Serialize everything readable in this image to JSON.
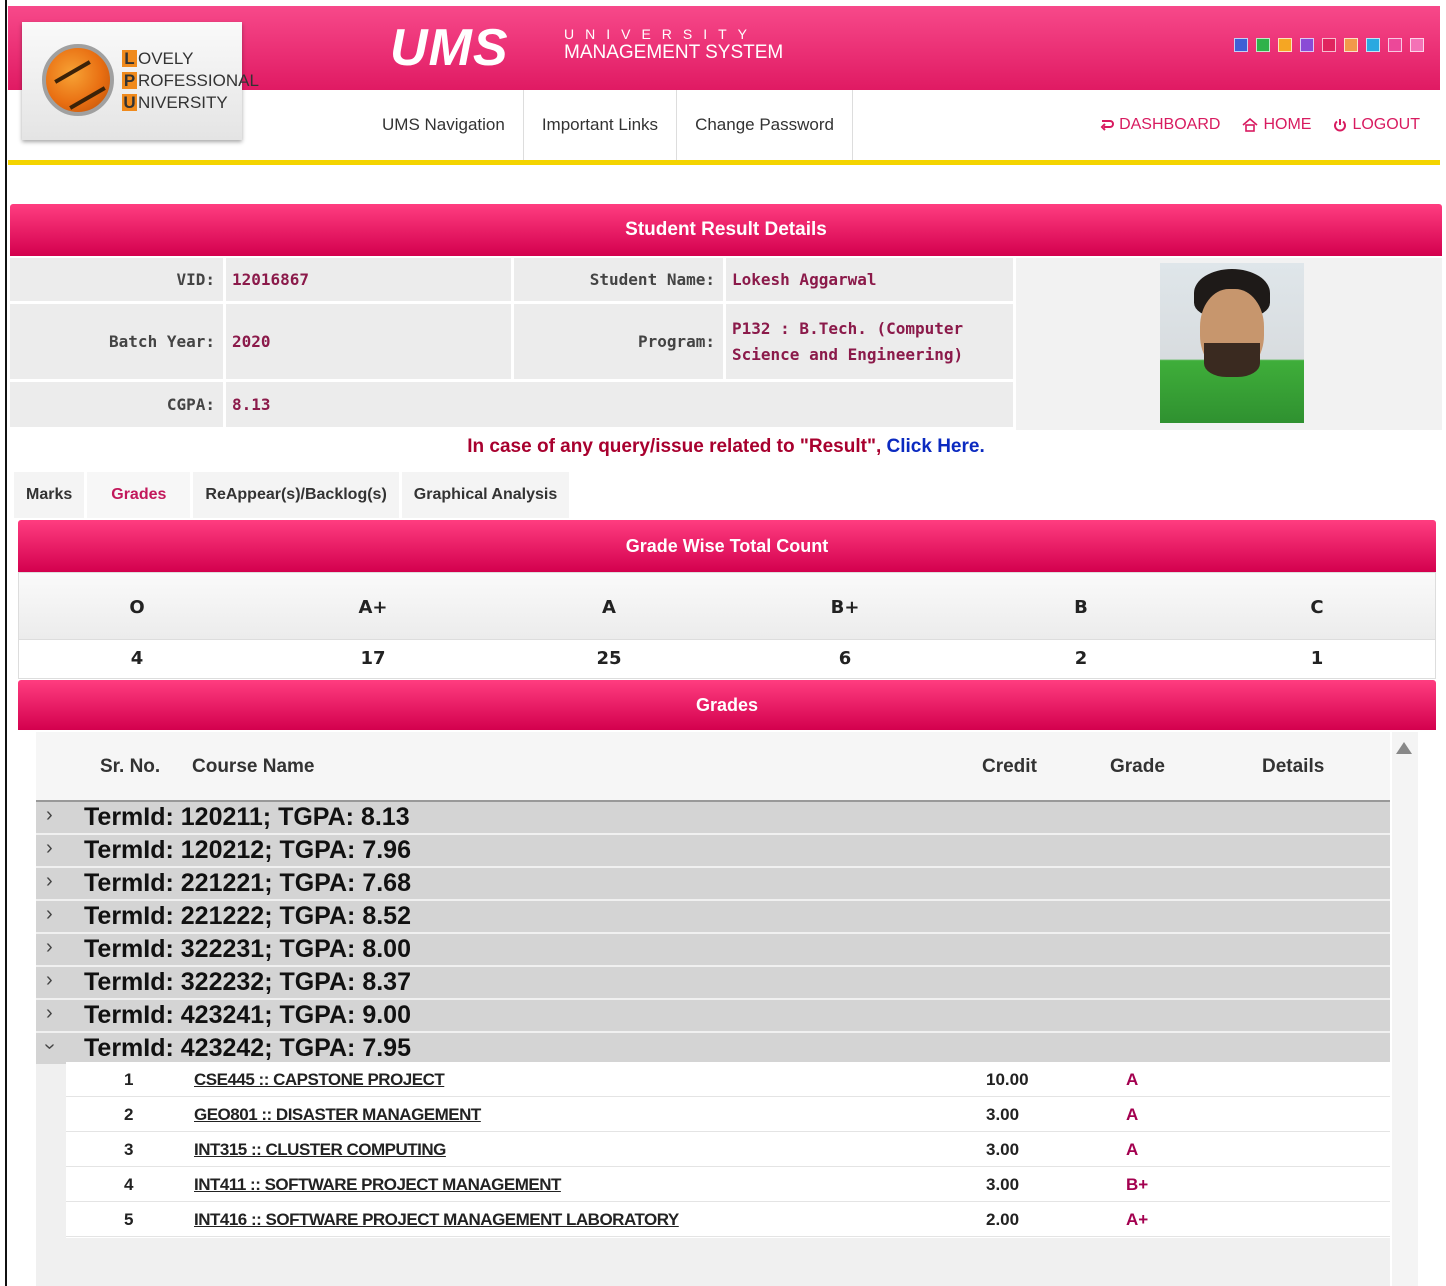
{
  "header": {
    "logo": {
      "line1_cap": "L",
      "line1_rest": "OVELY",
      "line2_cap": "P",
      "line2_rest": "ROFESSIONAL",
      "line3_cap": "U",
      "line3_rest": "NIVERSITY"
    },
    "brand_big": "UMS",
    "brand_small_1": "UNIVERSITY",
    "brand_small_2": "MANAGEMENT SYSTEM",
    "theme_swatches": [
      "#3f5fd6",
      "#2fb24a",
      "#f5a623",
      "#8a4bd6",
      "#e0245e",
      "#f2994a",
      "#29a9e0",
      "#ec4899",
      "#f472b6"
    ],
    "nav": [
      "UMS Navigation",
      "Important Links",
      "Change Password"
    ],
    "right_nav": {
      "dashboard": "DASHBOARD",
      "home": "HOME",
      "logout": "LOGOUT"
    },
    "icons": {
      "dashboard": "dashboard-icon",
      "home": "home-icon",
      "logout": "power-icon"
    }
  },
  "student": {
    "section_title": "Student Result Details",
    "vid_label": "VID:",
    "vid": "12016867",
    "name_label": "Student Name:",
    "name": "Lokesh Aggarwal",
    "batch_label": "Batch Year:",
    "batch": "2020",
    "program_label": "Program:",
    "program": "P132 : B.Tech. (Computer Science and Engineering)",
    "cgpa_label": "CGPA:",
    "cgpa": "8.13"
  },
  "query": {
    "text": "In case of any query/issue related to \"Result\", ",
    "link": "Click Here."
  },
  "tabs": [
    "Marks",
    "Grades",
    "ReAppear(s)/Backlog(s)",
    "Graphical Analysis"
  ],
  "active_tab": "Grades",
  "grade_count": {
    "title": "Grade Wise Total Count",
    "grades": [
      "O",
      "A+",
      "A",
      "B+",
      "B",
      "C"
    ],
    "counts": [
      "4",
      "17",
      "25",
      "6",
      "2",
      "1"
    ]
  },
  "grades": {
    "title": "Grades",
    "columns": {
      "sr": "Sr. No.",
      "course": "Course Name",
      "credit": "Credit",
      "grade": "Grade",
      "details": "Details"
    },
    "terms": [
      "TermId: 120211; TGPA: 8.13",
      "TermId: 120212; TGPA: 7.96",
      "TermId: 221221; TGPA: 7.68",
      "TermId: 221222; TGPA: 8.52",
      "TermId: 322231; TGPA: 8.00",
      "TermId: 322232; TGPA: 8.37",
      "TermId: 423241; TGPA: 9.00",
      "TermId: 423242; TGPA: 7.95"
    ],
    "expanded_term_index": 7,
    "courses": [
      {
        "sr": "1",
        "name": "CSE445 :: CAPSTONE PROJECT",
        "credit": "10.00",
        "grade": "A"
      },
      {
        "sr": "2",
        "name": "GEO801 :: DISASTER MANAGEMENT",
        "credit": "3.00",
        "grade": "A"
      },
      {
        "sr": "3",
        "name": "INT315 :: CLUSTER COMPUTING",
        "credit": "3.00",
        "grade": "A"
      },
      {
        "sr": "4",
        "name": "INT411 :: SOFTWARE PROJECT MANAGEMENT",
        "credit": "3.00",
        "grade": "B+"
      },
      {
        "sr": "5",
        "name": "INT416 :: SOFTWARE PROJECT MANAGEMENT LABORATORY",
        "credit": "2.00",
        "grade": "A+"
      }
    ]
  }
}
